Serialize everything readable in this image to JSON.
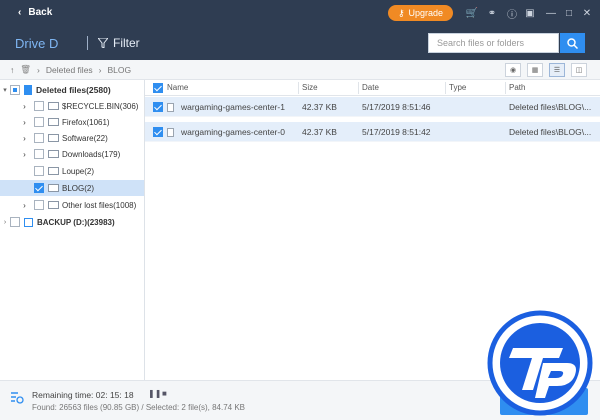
{
  "topbar": {
    "back_label": "Back",
    "upgrade_label": "Upgrade",
    "icons": [
      "cart-icon",
      "share-icon",
      "info-icon",
      "restore-icon",
      "minimize-icon",
      "maximize-icon",
      "close-icon"
    ]
  },
  "header": {
    "drive_label": "Drive D",
    "filter_label": "Filter",
    "search_placeholder": "Search files or folders"
  },
  "breadcrumb": {
    "items": [
      "Deleted files",
      "BLOG"
    ]
  },
  "tree": {
    "root": {
      "label": "Deleted files(2580)"
    },
    "children": [
      {
        "label": "$RECYCLE.BIN(306)"
      },
      {
        "label": "Firefox(1061)"
      },
      {
        "label": "Software(22)"
      },
      {
        "label": "Downloads(179)"
      },
      {
        "label": "Loupe(2)"
      },
      {
        "label": "BLOG(2)"
      },
      {
        "label": "Other lost files(1008)"
      }
    ],
    "backup": {
      "label": "BACKUP (D:)(23983)"
    }
  },
  "table": {
    "columns": [
      "Name",
      "Size",
      "Date",
      "Type",
      "Path"
    ],
    "rows": [
      {
        "name": "wargaming-games-center-1",
        "size": "42.37 KB",
        "date": "5/17/2019 8:51:46",
        "type": "",
        "path": "Deleted files\\BLOG\\..."
      },
      {
        "name": "wargaming-games-center-0",
        "size": "42.37 KB",
        "date": "5/17/2019 8:51:42",
        "type": "",
        "path": "Deleted files\\BLOG\\..."
      }
    ]
  },
  "footer": {
    "remaining": "Remaining time: 02: 15: 18",
    "stats": "Found: 26563 files (90.85 GB) / Selected: 2 file(s), 84.74 KB",
    "recover_label": "Recover"
  },
  "colors": {
    "topbar": "#2f3d52",
    "accent": "#2f8ef0",
    "upgrade": "#f08a24",
    "selected_row": "#e4eefa"
  }
}
